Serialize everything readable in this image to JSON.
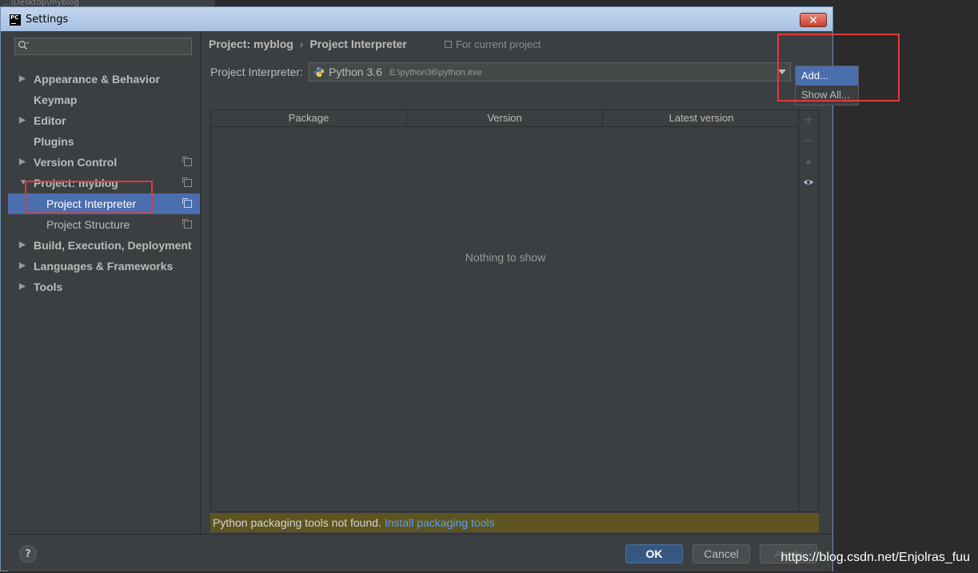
{
  "background_title": "...\\Desktop\\myblog",
  "window": {
    "title": "Settings",
    "icon_text": "PC",
    "close_symbol": "✕"
  },
  "sidebar": {
    "search": {
      "value": "",
      "placeholder": ""
    },
    "items": [
      {
        "label": "Appearance & Behavior",
        "expandable": true,
        "expanded": false,
        "project_icon": false
      },
      {
        "label": "Keymap",
        "expandable": false,
        "project_icon": false
      },
      {
        "label": "Editor",
        "expandable": true,
        "expanded": false,
        "project_icon": false
      },
      {
        "label": "Plugins",
        "expandable": false,
        "project_icon": false
      },
      {
        "label": "Version Control",
        "expandable": true,
        "expanded": false,
        "project_icon": true
      },
      {
        "label": "Project: myblog",
        "expandable": true,
        "expanded": true,
        "project_icon": true
      },
      {
        "label": "Project Interpreter",
        "child": true,
        "selected": true,
        "project_icon": true
      },
      {
        "label": "Project Structure",
        "child": true,
        "project_icon": true
      },
      {
        "label": "Build, Execution, Deployment",
        "expandable": true,
        "expanded": false,
        "project_icon": false
      },
      {
        "label": "Languages & Frameworks",
        "expandable": true,
        "expanded": false,
        "project_icon": false
      },
      {
        "label": "Tools",
        "expandable": true,
        "expanded": false,
        "project_icon": false
      }
    ]
  },
  "main": {
    "breadcrumb": {
      "parent": "Project: myblog",
      "separator": "›",
      "current": "Project Interpreter"
    },
    "scope_note": "For current project",
    "interpreter": {
      "label": "Project Interpreter:",
      "name": "Python 3.6",
      "path": "E:\\python36\\python.exe"
    },
    "gear_menu": {
      "items": [
        "Add...",
        "Show All..."
      ],
      "active_index": 0
    },
    "table": {
      "columns": [
        "Package",
        "Version",
        "Latest version"
      ],
      "rows": [],
      "empty_text": "Nothing to show",
      "toolbar": [
        {
          "name": "add-package-icon",
          "symbol": "+",
          "enabled": false
        },
        {
          "name": "remove-package-icon",
          "symbol": "−",
          "enabled": false
        },
        {
          "name": "upgrade-package-icon",
          "symbol": "▲",
          "enabled": false
        },
        {
          "name": "show-early-releases-icon",
          "symbol": "👁",
          "enabled": true
        }
      ]
    },
    "warning": {
      "text": "Python packaging tools not found.",
      "link": "Install packaging tools"
    }
  },
  "footer": {
    "help": "?",
    "ok": "OK",
    "cancel": "Cancel",
    "apply": "Apply"
  },
  "watermark": "https://blog.csdn.net/Enjolras_fuu",
  "colors": {
    "selection": "#4b6eaf",
    "highlight_box": "#e03a3a",
    "link": "#589df6",
    "warning_bg": "#5e5420",
    "ok_button": "#365880"
  }
}
